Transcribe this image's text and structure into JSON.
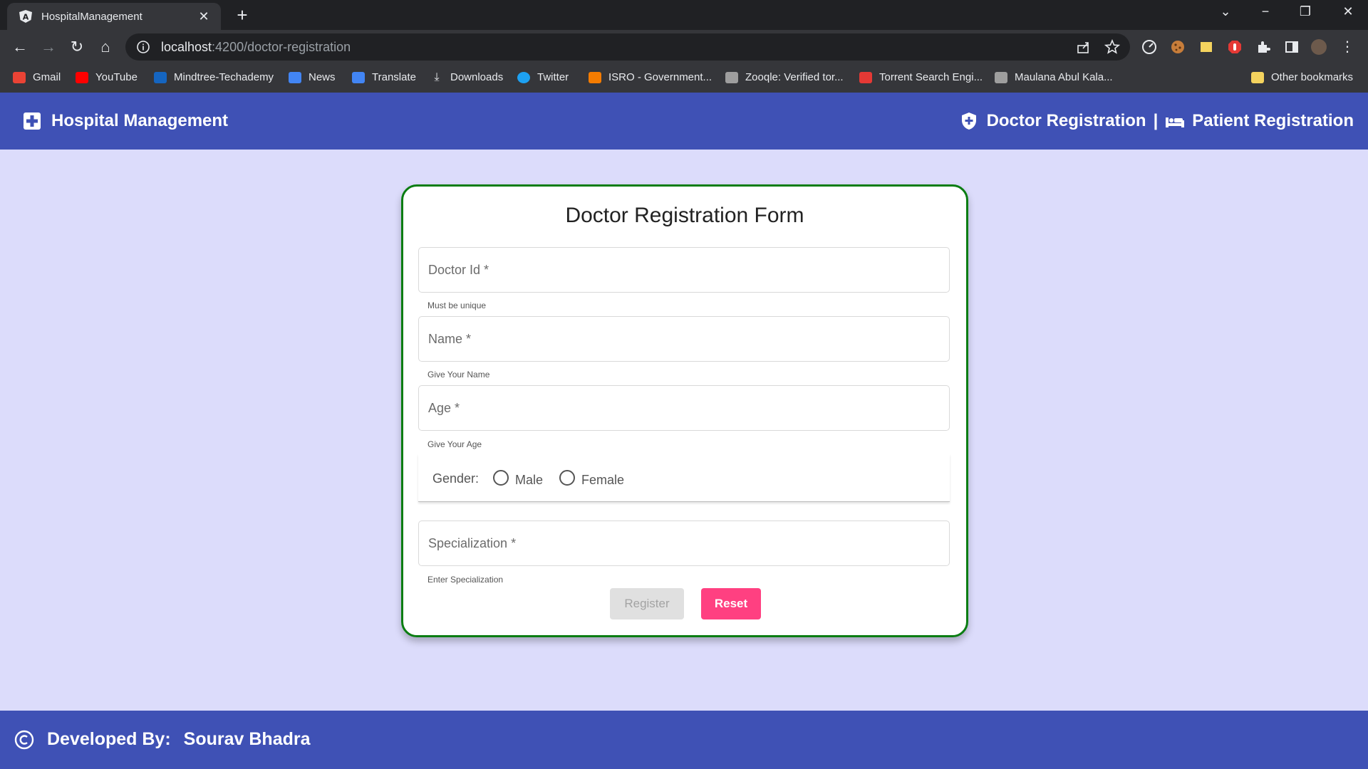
{
  "browser": {
    "tab_title": "HospitalManagement",
    "url_host": "localhost",
    "url_path": ":4200/doctor-registration",
    "bookmarks": [
      {
        "label": "Gmail",
        "icon": "gmail-icon",
        "color": "#ea4335"
      },
      {
        "label": "YouTube",
        "icon": "youtube-icon",
        "color": "#ff0000"
      },
      {
        "label": "Mindtree-Techademy",
        "icon": "mindtree-icon",
        "color": "#1565c0"
      },
      {
        "label": "News",
        "icon": "news-icon",
        "color": "#4285f4"
      },
      {
        "label": "Translate",
        "icon": "translate-icon",
        "color": "#4285f4"
      },
      {
        "label": "Downloads",
        "icon": "download-icon",
        "color": "#e8eaed"
      },
      {
        "label": "Twitter",
        "icon": "twitter-icon",
        "color": "#1da1f2"
      },
      {
        "label": "ISRO - Government...",
        "icon": "isro-icon",
        "color": "#f57c00"
      },
      {
        "label": "Zooqle: Verified tor...",
        "icon": "zooqle-icon",
        "color": "#9e9e9e"
      },
      {
        "label": "Torrent Search Engi...",
        "icon": "torrent-icon",
        "color": "#e53935"
      },
      {
        "label": "Maulana Abul Kala...",
        "icon": "graduation-icon",
        "color": "#9e9e9e"
      }
    ],
    "other_bookmarks": "Other bookmarks"
  },
  "app": {
    "brand": "Hospital Management",
    "nav_doctor": "Doctor Registration",
    "nav_separator": "|",
    "nav_patient": "Patient Registration",
    "accent": "#3f51b5"
  },
  "form": {
    "title": "Doctor Registration Form",
    "doctor_id_label": "Doctor Id *",
    "doctor_id_hint": "Must be unique",
    "name_label": "Name *",
    "name_hint": "Give Your Name",
    "age_label": "Age *",
    "age_hint": "Give Your Age",
    "gender_label": "Gender:",
    "gender_male": "Male",
    "gender_female": "Female",
    "specialization_label": "Specialization *",
    "specialization_hint": "Enter Specialization",
    "register_label": "Register",
    "reset_label": "Reset",
    "reset_color": "#ff4081",
    "border_color": "#0a7d12"
  },
  "footer": {
    "developed_by": "Developed By:",
    "developer": "Sourav Bhadra"
  }
}
